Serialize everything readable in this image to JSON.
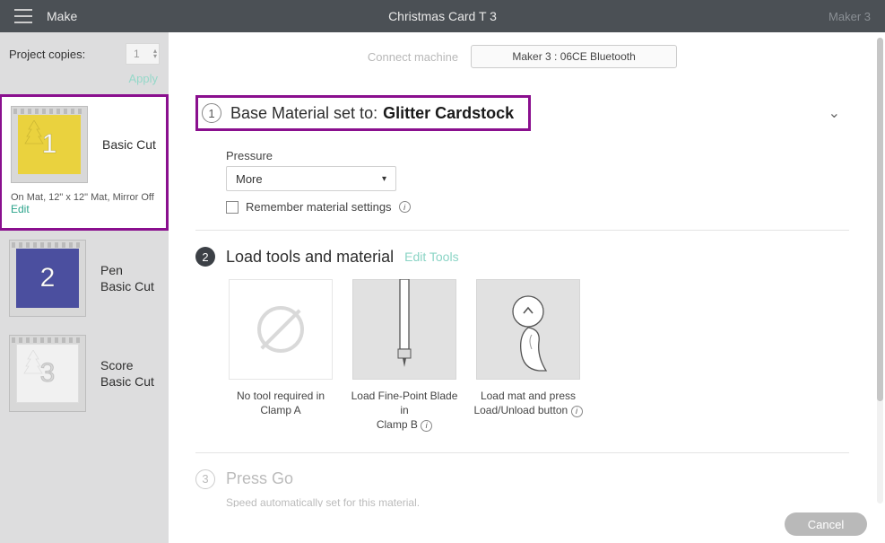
{
  "header": {
    "make": "Make",
    "title": "Christmas Card T 3",
    "device": "Maker 3"
  },
  "project": {
    "copies_label": "Project copies:",
    "copies_value": "1",
    "apply": "Apply"
  },
  "mats": [
    {
      "num": "1",
      "label": "Basic Cut",
      "meta": "On Mat, 12\" x 12\" Mat, Mirror Off",
      "edit": "Edit",
      "color": "yellow",
      "selected": true
    },
    {
      "num": "2",
      "label_line1": "Pen",
      "label_line2": "Basic Cut",
      "color": "blue"
    },
    {
      "num": "3",
      "label_line1": "Score",
      "label_line2": "Basic Cut",
      "color": "grey"
    }
  ],
  "machine": {
    "connect_label": "Connect machine",
    "selected": "Maker 3 : 06CE Bluetooth"
  },
  "step1": {
    "num": "1",
    "title_prefix": "Base Material set to:",
    "material": "Glitter Cardstock",
    "pressure_label": "Pressure",
    "pressure_value": "More",
    "remember": "Remember material settings"
  },
  "step2": {
    "num": "2",
    "title": "Load tools and material",
    "edit_link": "Edit Tools",
    "tools": [
      {
        "caption_l1": "No tool required in",
        "caption_l2": "Clamp A"
      },
      {
        "caption_l1": "Load Fine-Point Blade in",
        "caption_l2": "Clamp B"
      },
      {
        "caption_l1": "Load mat and press",
        "caption_l2": "Load/Unload button"
      }
    ]
  },
  "step3": {
    "num": "3",
    "title": "Press Go",
    "note": "Speed automatically set for this material."
  },
  "footer": {
    "cancel": "Cancel"
  }
}
